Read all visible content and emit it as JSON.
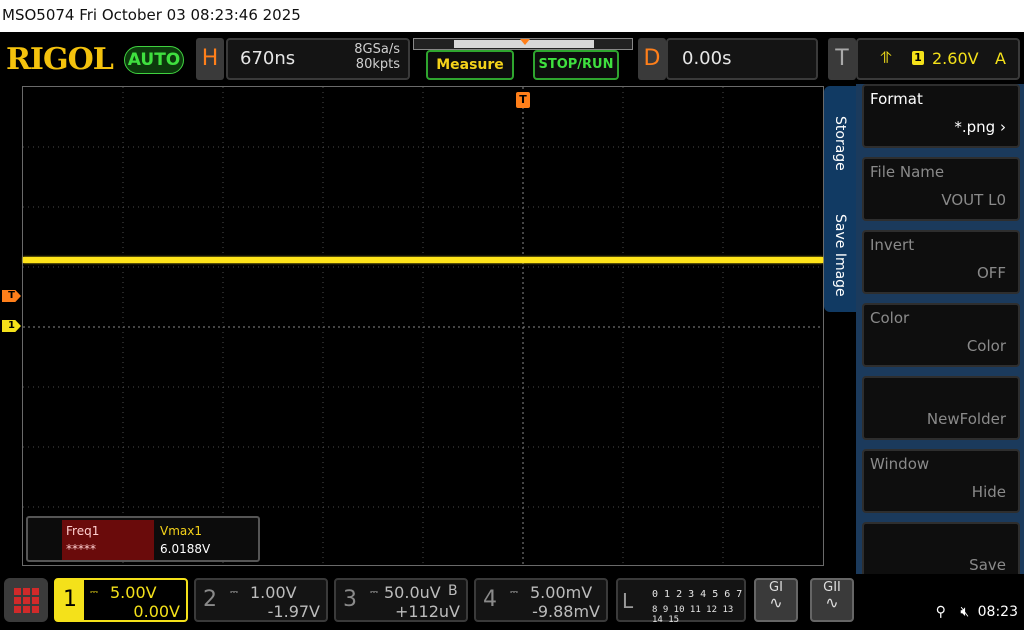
{
  "titlebar": {
    "text": "MSO5074  Fri October 03 08:23:46 2025"
  },
  "brand": {
    "logo": "RIGOL",
    "mode": "AUTO"
  },
  "horizontal": {
    "letter": "H",
    "timebase": "670ns",
    "sample_rate": "8GSa/s",
    "mem_depth": "80kpts"
  },
  "delay": {
    "letter": "D",
    "value": "0.00s"
  },
  "trigger": {
    "letter": "T",
    "channel": "1",
    "level": "2.60V",
    "mode": "A"
  },
  "buttons": {
    "measure": "Measure",
    "stop_run": "STOP/RUN"
  },
  "markers": {
    "trigger_top": "T",
    "left_trigger": "T",
    "left_ch1": "1"
  },
  "measurement": {
    "label_1": "Freq1",
    "value_1": "*****",
    "label_2": "Vmax1",
    "value_2": "6.0188V"
  },
  "side_menu": {
    "tab_top": "Storage",
    "tab_bottom": "Save Image",
    "items": [
      {
        "label": "Format",
        "value": "*.png"
      },
      {
        "label": "File Name",
        "value": "VOUT L0"
      },
      {
        "label": "Invert",
        "value": "OFF"
      },
      {
        "label": "Color",
        "value": "Color"
      },
      {
        "label": "",
        "value": "NewFolder"
      },
      {
        "label": "Window",
        "value": "Hide"
      },
      {
        "label": "",
        "value": "Save"
      }
    ]
  },
  "channels": [
    {
      "num": "1",
      "scale": "5.00V",
      "offset": "0.00V",
      "bw": ""
    },
    {
      "num": "2",
      "scale": "1.00V",
      "offset": "-1.97V",
      "bw": ""
    },
    {
      "num": "3",
      "scale": "50.0uV",
      "offset": "+112uV",
      "bw": "B"
    },
    {
      "num": "4",
      "scale": "5.00mV",
      "offset": "-9.88mV",
      "bw": ""
    }
  ],
  "logic": {
    "letter": "L",
    "row1": "0 1 2 3  4 5 6 7",
    "row2": "8 9 10 11 12 13 14 15"
  },
  "generators": {
    "g1": "GI",
    "g2": "GII"
  },
  "status": {
    "time": "08:23"
  },
  "colors": {
    "ch1": "#f4e11a",
    "trigger": "#ff7f1a",
    "accent_green": "#3fe03f",
    "menu_blue": "#1b3a5c"
  }
}
